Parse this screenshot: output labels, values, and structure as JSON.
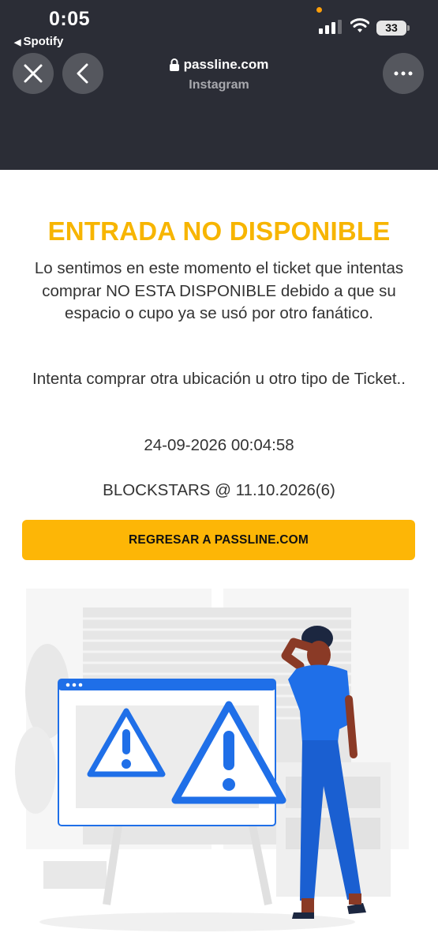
{
  "status_bar": {
    "time": "0:05",
    "back_app": "Spotify",
    "battery": "33"
  },
  "browser": {
    "url": "passline.com",
    "source": "Instagram"
  },
  "page": {
    "title": "ENTRADA NO DISPONIBLE",
    "message": "Lo sentimos en este momento el ticket que intentas comprar NO ESTA DISPONIBLE debido a que su espacio o cupo ya se usó por otro fanático.",
    "message2": "Intenta comprar otra ubicación u otro tipo de Ticket..",
    "datetime": "24-09-2026 00:04:58",
    "event": "BLOCKSTARS @ 11.10.2026(6)",
    "button_label": "REGRESAR A PASSLINE.COM"
  },
  "colors": {
    "chrome_bg": "#2b2d36",
    "accent_yellow": "#f7b500",
    "button_yellow": "#fdb606",
    "illustration_blue": "#1f6fe8"
  },
  "icons": [
    "close-icon",
    "back-chevron-icon",
    "more-icon",
    "lock-icon",
    "signal-icon",
    "wifi-icon",
    "battery-icon",
    "warning-icon"
  ]
}
